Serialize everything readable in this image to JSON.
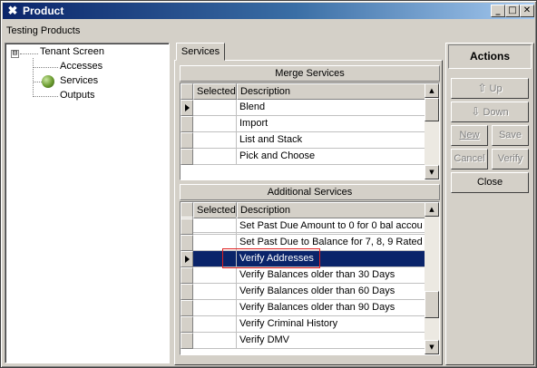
{
  "window": {
    "title": "Product",
    "icon": "close-x-icon",
    "controls": [
      "minimize-icon",
      "maximize-icon",
      "close-icon"
    ]
  },
  "header": {
    "label": "Testing Products"
  },
  "tree": {
    "root": "Tenant Screen",
    "children": [
      {
        "label": "Accesses"
      },
      {
        "label": "Services",
        "icon": "green-orb-icon"
      },
      {
        "label": "Outputs"
      }
    ],
    "expander": "⊟"
  },
  "tabs": [
    {
      "label": "Services"
    }
  ],
  "merge_services": {
    "title": "Merge Services",
    "columns": [
      "Selected",
      "Description"
    ],
    "rows": [
      {
        "description": "Blend"
      },
      {
        "description": "Import"
      },
      {
        "description": "List and Stack"
      },
      {
        "description": "Pick and Choose"
      }
    ]
  },
  "additional_services": {
    "title": "Additional Services",
    "columns": [
      "Selected",
      "Description"
    ],
    "rows": [
      {
        "description": ""
      },
      {
        "description": "Set Past Due Amount to 0 for 0 bal accou"
      },
      {
        "description": "Set Past Due to Balance for 7, 8, 9 Rated"
      },
      {
        "description": "Verify Addresses",
        "selected": true
      },
      {
        "description": "Verify Balances older than 30 Days"
      },
      {
        "description": "Verify Balances older than 60 Days"
      },
      {
        "description": "Verify Balances older than 90 Days"
      },
      {
        "description": "Verify Criminal History"
      },
      {
        "description": "Verify DMV"
      }
    ]
  },
  "actions": {
    "title": "Actions",
    "up": "Up",
    "down": "Down",
    "new": "New",
    "save": "Save",
    "cancel": "Cancel",
    "verify": "Verify",
    "close": "Close"
  }
}
